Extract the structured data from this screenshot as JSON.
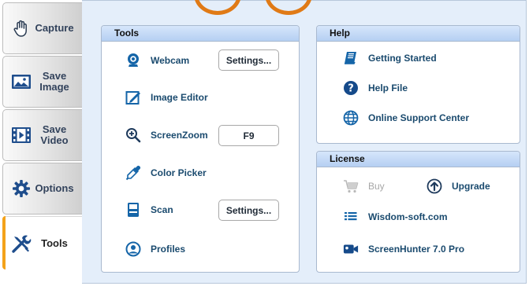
{
  "sidebar": {
    "tabs": [
      {
        "label": "Capture",
        "icon": "hand-icon",
        "active": false
      },
      {
        "label": "Save\nImage",
        "icon": "image-icon",
        "active": false
      },
      {
        "label": "Save\nVideo",
        "icon": "film-icon",
        "active": false
      },
      {
        "label": "Options",
        "icon": "gear-icon",
        "active": false
      },
      {
        "label": "Tools",
        "icon": "tools-icon",
        "active": true
      }
    ]
  },
  "tools": {
    "title": "Tools",
    "items": [
      {
        "label": "Webcam",
        "icon": "webcam-icon",
        "button": "Settings..."
      },
      {
        "label": "Image Editor",
        "icon": "image-editor-icon"
      },
      {
        "label": "ScreenZoom",
        "icon": "zoom-in-icon",
        "button": "F9"
      },
      {
        "label": "Color Picker",
        "icon": "eyedropper-icon"
      },
      {
        "label": "Scan",
        "icon": "scanner-icon",
        "button": "Settings..."
      },
      {
        "label": "Profiles",
        "icon": "profile-icon"
      }
    ]
  },
  "help": {
    "title": "Help",
    "items": [
      {
        "label": "Getting Started",
        "icon": "book-icon"
      },
      {
        "label": "Help File",
        "icon": "question-icon"
      },
      {
        "label": "Online Support Center",
        "icon": "globe-icon"
      }
    ]
  },
  "license": {
    "title": "License",
    "buy": "Buy",
    "upgrade": "Upgrade",
    "website": "Wisdom-soft.com",
    "product": "ScreenHunter 7.0 Pro"
  },
  "colors": {
    "accent": "#f4a21a",
    "panel_header": "#c4dbf7",
    "link_text": "#1a4a6e",
    "icon_blue": "#1565a8"
  }
}
